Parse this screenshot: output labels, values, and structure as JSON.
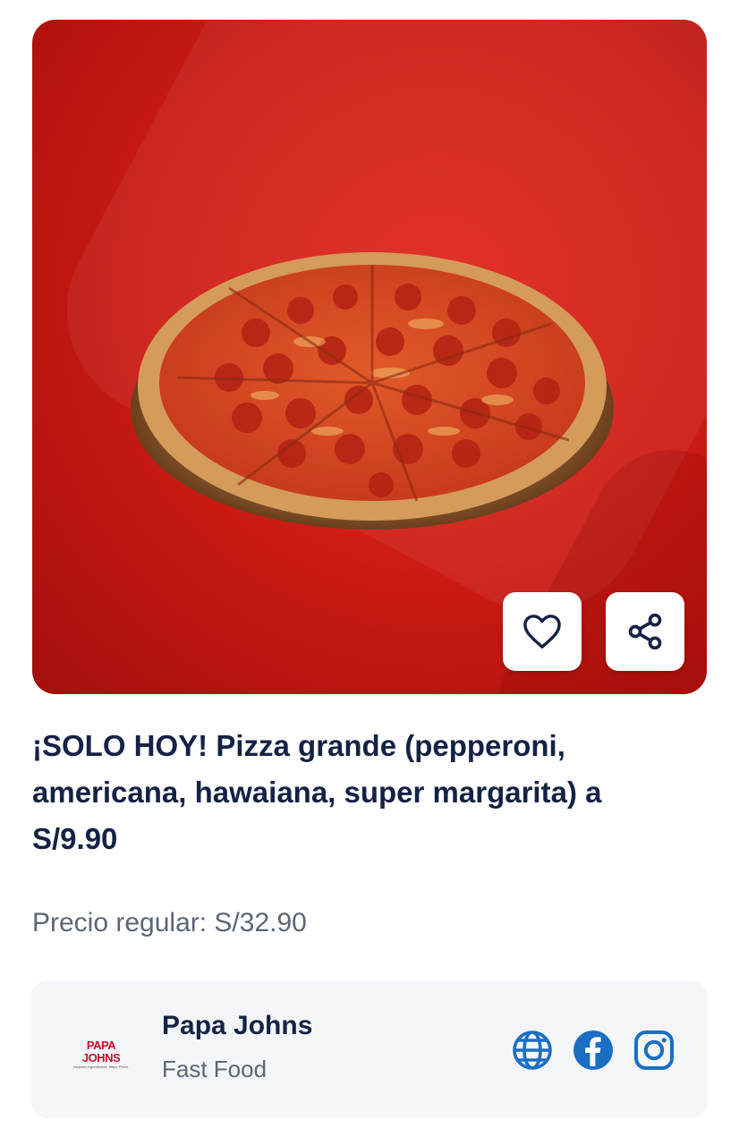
{
  "offer": {
    "title": "¡SOLO HOY! Pizza grande (pepperoni, americana, hawaiana, super margarita) a S/9.90",
    "regular_price": "Precio regular: S/32.90",
    "image_icon": "pepperoni-pizza-image"
  },
  "actions": {
    "favorite_icon": "heart-icon",
    "share_icon": "share-icon"
  },
  "merchant": {
    "name": "Papa Johns",
    "category": "Fast Food",
    "logo_text": "PAPA JOHNS",
    "logo_tagline": "Mejores Ingredientes. Mejor Pizza.",
    "links": [
      "globe-icon",
      "facebook-icon",
      "instagram-icon"
    ]
  },
  "colors": {
    "brand_red": "#d8231a",
    "title_navy": "#142245",
    "icon_blue": "#1a6ec4"
  }
}
